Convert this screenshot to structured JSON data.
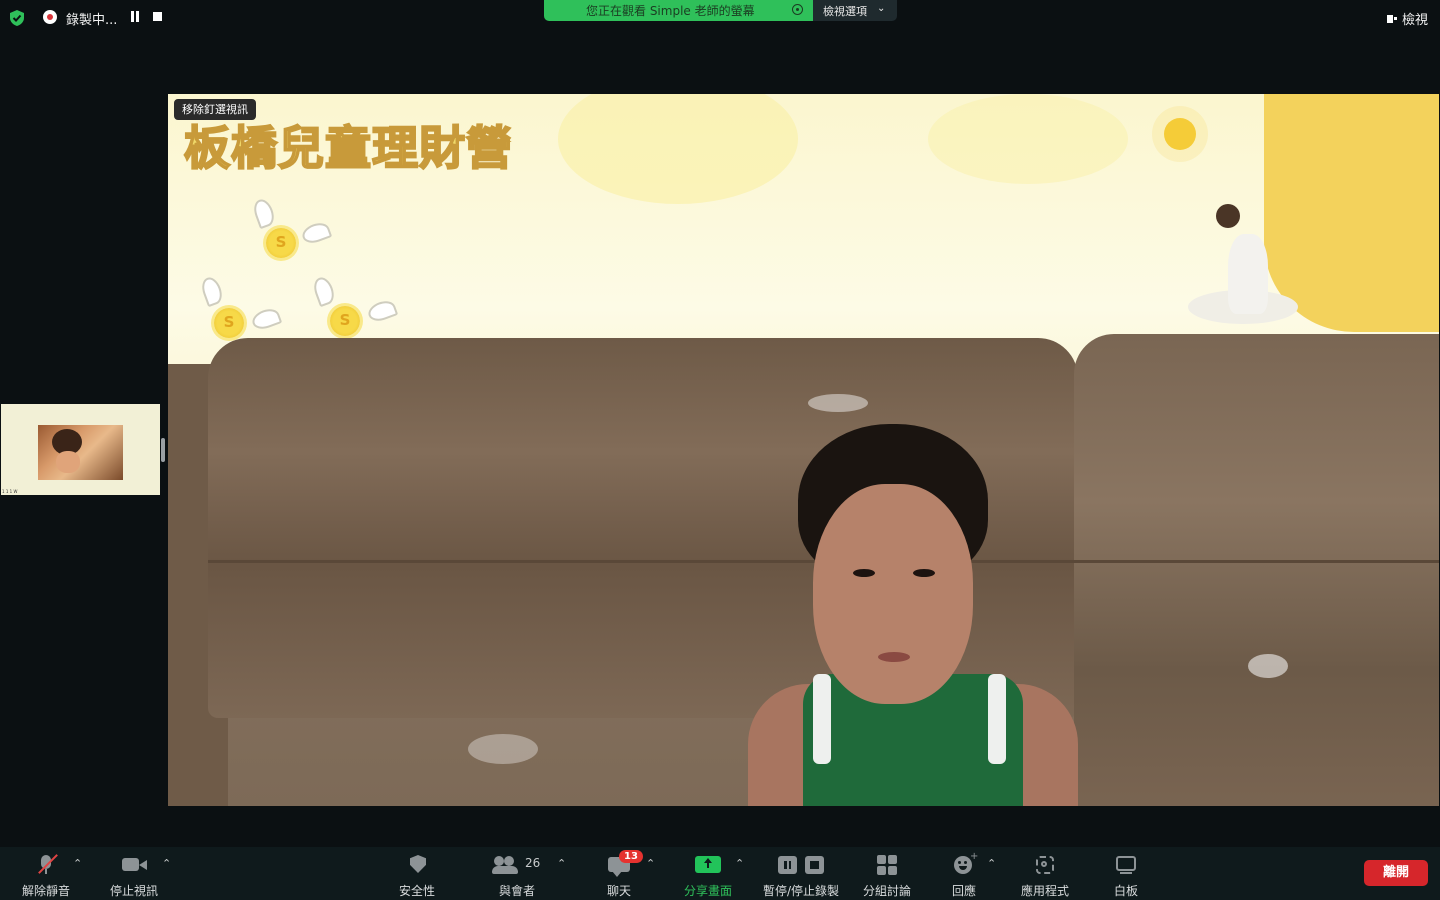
{
  "topbar": {
    "security_icon": "shield-check-icon",
    "security_color": "#2fc05a",
    "recording": {
      "label": "錄製中...",
      "pause_icon": "pause-icon",
      "stop_icon": "stop-icon"
    },
    "share_banner": {
      "text": "您正在觀看 Simple 老師的螢幕",
      "view_options_label": "檢視選項",
      "color": "#2fc05a"
    },
    "view_button_label": "檢視"
  },
  "thumbnail": {
    "name": "1 1 1 W"
  },
  "main_video": {
    "unpin_label": "移除釘選視訊",
    "background_title": "板橋兒童理財營",
    "coin_symbol": "S"
  },
  "toolbar": {
    "items": [
      {
        "label": "解除靜音",
        "icon": "microphone-muted-icon"
      },
      {
        "label": "停止視訊",
        "icon": "video-camera-icon"
      },
      {
        "label": "安全性",
        "icon": "shield-icon"
      },
      {
        "label": "與會者",
        "icon": "participants-icon",
        "count": "26"
      },
      {
        "label": "聊天",
        "icon": "chat-icon",
        "badge": "13"
      },
      {
        "label": "分享畫面",
        "icon": "share-screen-icon"
      },
      {
        "label": "暫停/停止錄製",
        "icon": "pause-stop-record-icon"
      },
      {
        "label": "分組討論",
        "icon": "breakout-rooms-icon"
      },
      {
        "label": "回應",
        "icon": "reactions-icon"
      },
      {
        "label": "應用程式",
        "icon": "apps-icon"
      },
      {
        "label": "白板",
        "icon": "whiteboard-icon"
      }
    ],
    "chevron": "⌃",
    "leave_label": "離開",
    "leave_color": "#d6262b",
    "share_color": "#22c35a"
  }
}
